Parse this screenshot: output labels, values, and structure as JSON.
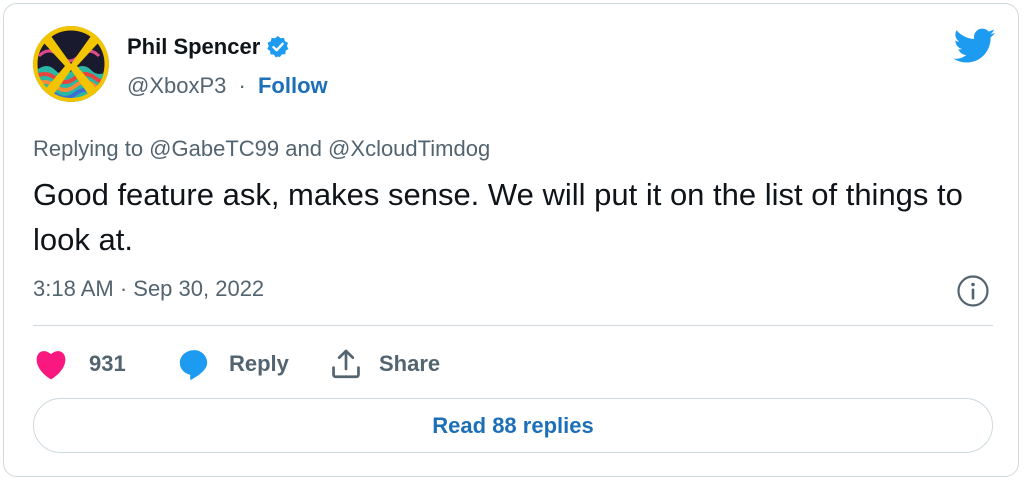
{
  "author": {
    "name": "Phil Spencer",
    "handle": "@XboxP3",
    "separator": "·",
    "follow_label": "Follow"
  },
  "tweet": {
    "replying_to": "Replying to @GabeTC99 and @XcloudTimdog",
    "text": "Good feature ask, makes sense. We will put it on the list of things to look at.",
    "timestamp": "3:18 AM · Sep 30, 2022"
  },
  "actions": {
    "likes": "931",
    "reply_label": "Reply",
    "share_label": "Share"
  },
  "read_replies_label": "Read 88 replies",
  "colors": {
    "accent": "#1d9bf0",
    "link": "#1d6fb8",
    "like": "#f91880",
    "text": "#0f1419",
    "muted": "#536471",
    "border": "#cfd9de"
  },
  "icons": [
    "verified-badge-icon",
    "twitter-bird-icon",
    "info-icon",
    "heart-icon",
    "reply-bubble-icon",
    "share-icon"
  ]
}
